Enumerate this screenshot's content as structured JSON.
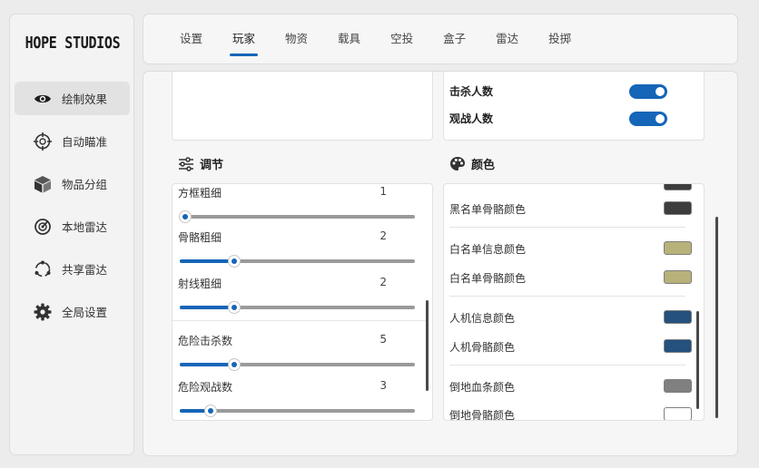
{
  "app": {
    "logo": "HOPE STUDIOS"
  },
  "sidebar": {
    "items": [
      {
        "label": "绘制效果",
        "icon": "eye-icon",
        "active": true
      },
      {
        "label": "自动瞄准",
        "icon": "crosshair-icon",
        "active": false
      },
      {
        "label": "物品分组",
        "icon": "box-icon",
        "active": false
      },
      {
        "label": "本地雷达",
        "icon": "radar-icon",
        "active": false
      },
      {
        "label": "共享雷达",
        "icon": "share-radar-icon",
        "active": false
      },
      {
        "label": "全局设置",
        "icon": "gear-icon",
        "active": false
      }
    ]
  },
  "tabs": [
    "设置",
    "玩家",
    "物资",
    "载具",
    "空投",
    "盒子",
    "雷达",
    "投掷"
  ],
  "active_tab": "玩家",
  "toggles": [
    {
      "label": "击杀人数",
      "on": true
    },
    {
      "label": "观战人数",
      "on": true
    }
  ],
  "adjust": {
    "title": "调节",
    "sliders": [
      {
        "label": "方框粗细",
        "value": "1",
        "fraction": 0.0
      },
      {
        "label": "骨骼粗细",
        "value": "2",
        "fraction": 0.23
      },
      {
        "label": "射线粗细",
        "value": "2",
        "fraction": 0.23
      },
      {
        "label": "危险击杀数",
        "value": "5",
        "fraction": 0.23
      },
      {
        "label": "危险观战数",
        "value": "3",
        "fraction": 0.13
      }
    ]
  },
  "colors": {
    "title": "颜色",
    "items": [
      {
        "label": "黑名单骨骼颜色",
        "color": "#3d3d3d"
      },
      {
        "label": "白名单信息颜色",
        "color": "#b8b27a"
      },
      {
        "label": "白名单骨骼颜色",
        "color": "#b8b27a"
      },
      {
        "label": "人机信息颜色",
        "color": "#24517e"
      },
      {
        "label": "人机骨骼颜色",
        "color": "#24517e"
      },
      {
        "label": "倒地血条颜色",
        "color": "#808080"
      },
      {
        "label": "倒地骨骼颜色",
        "color": "#ffffff"
      }
    ]
  },
  "accent": "#1565b8"
}
